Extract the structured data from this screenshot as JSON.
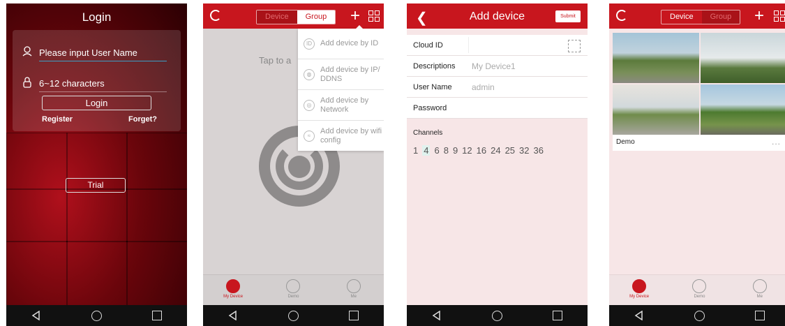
{
  "screen1": {
    "title": "Login",
    "username_placeholder": "Please input User Name",
    "password_placeholder": "6~12 characters",
    "login_label": "Login",
    "register_label": "Register",
    "forget_label": "Forget?",
    "trial_label": "Trial"
  },
  "screen2": {
    "tabs": [
      "Device",
      "Group"
    ],
    "tap_text": "Tap to a",
    "menu": [
      {
        "label": "Add device by ID",
        "icon": "id-icon"
      },
      {
        "label": "Add device by IP/ DDNS",
        "icon": "globe-icon"
      },
      {
        "label": "Add device by Network",
        "icon": "network-icon"
      },
      {
        "label": "Add device by wifi config",
        "icon": "wifi-icon"
      }
    ],
    "bottom_tabs": [
      "My Device",
      "Demo",
      "Me"
    ]
  },
  "screen3": {
    "title": "Add device",
    "submit_label": "Submit",
    "fields": [
      {
        "label": "Cloud ID",
        "value": ""
      },
      {
        "label": "Descriptions",
        "value": "My Device1"
      },
      {
        "label": "User Name",
        "value": "admin"
      },
      {
        "label": "Password",
        "value": ""
      }
    ],
    "channels_label": "Channels",
    "channels": [
      "1",
      "4",
      "6",
      "8",
      "9",
      "12",
      "16",
      "24",
      "25",
      "32",
      "36"
    ],
    "selected_channel": "4"
  },
  "screen4": {
    "tabs": [
      "Device",
      "Group"
    ],
    "device_name": "Demo",
    "more_label": "...",
    "bottom_tabs": [
      "My Device",
      "Demo",
      "Me"
    ]
  },
  "colors": {
    "accent": "#c8161e",
    "background": "#f7e6e7",
    "navbar": "#111111"
  }
}
